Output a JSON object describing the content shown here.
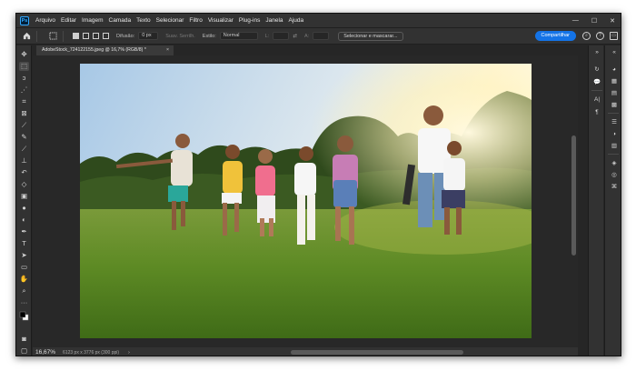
{
  "app": {
    "logo": "Ps",
    "menu": [
      "Arquivo",
      "Editar",
      "Imagem",
      "Camada",
      "Texto",
      "Selecionar",
      "Filtro",
      "Visualizar",
      "Plug-ins",
      "Janela",
      "Ajuda"
    ],
    "window_controls": {
      "minimize": "—",
      "maximize": "☐",
      "close": "✕"
    }
  },
  "options_bar": {
    "home_icon": "home-icon",
    "feather_label": "Difusão:",
    "feather_value": "0 px",
    "antialias_label": "Suav. Serrilh.",
    "style_label": "Estilo:",
    "style_value": "Normal",
    "width_label": "L:",
    "height_label": "A:",
    "select_mask_button": "Selecionar e mascarar...",
    "share_button": "Compartilhar"
  },
  "document": {
    "tab_title": "AdobeStock_724122155.jpeg @ 16,7% (RGB/8) *",
    "tab_close": "×"
  },
  "status": {
    "zoom": "16,67%",
    "dimensions": "6123 px x 3776 px (300 ppi)",
    "arrow": "›"
  },
  "tools": [
    "move-icon",
    "marquee-icon",
    "lasso-icon",
    "quick-select-icon",
    "crop-icon",
    "frame-icon",
    "eyedropper-icon",
    "healing-icon",
    "brush-icon",
    "stamp-icon",
    "history-brush-icon",
    "eraser-icon",
    "gradient-icon",
    "blur-icon",
    "dodge-icon",
    "pen-icon",
    "type-icon",
    "path-select-icon",
    "rectangle-icon",
    "hand-icon",
    "zoom-icon",
    "more-icon",
    "colors-icon",
    "quickmask-icon",
    "screenmode-icon"
  ],
  "colors": {
    "accent": "#1473e6",
    "ps_blue": "#31a8ff"
  }
}
